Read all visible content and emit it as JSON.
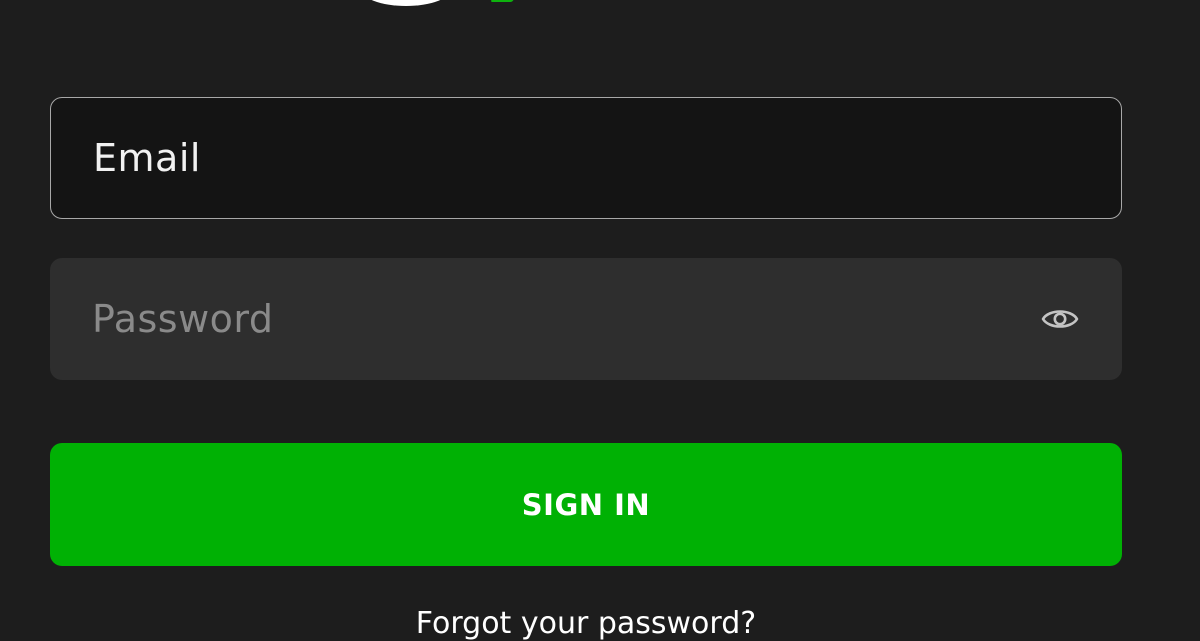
{
  "brand": {
    "logo_icon": "brand-logo-icon",
    "accent_color": "#00b104"
  },
  "form": {
    "email": {
      "placeholder": "Email",
      "value": ""
    },
    "password": {
      "placeholder": "Password",
      "value": "",
      "toggle_icon": "eye-icon"
    },
    "sign_in_label": "SIGN IN",
    "forgot_label": "Forgot your password?"
  },
  "colors": {
    "background": "#1d1d1d",
    "email_field_bg": "#141414",
    "password_field_bg": "#2e2e2e",
    "button_bg": "#00b104",
    "text": "#ffffff",
    "placeholder_text": "#8a8a8a"
  }
}
